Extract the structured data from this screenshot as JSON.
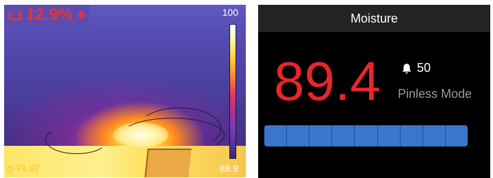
{
  "thermal": {
    "reading": "12.9%",
    "scale_max": "100",
    "scale_min": "88.9",
    "brand": "FLIR",
    "icons": {
      "moisture": "moisture-meter-icon",
      "alarm": "bell-icon"
    }
  },
  "panel": {
    "title": "Moisture",
    "value": "89.4",
    "alarm_threshold": "50",
    "mode": "Pinless Mode",
    "bar_segments": 9,
    "colors": {
      "value": "#e8252c",
      "bar": "#3a77cc",
      "header_bg": "#232323"
    }
  }
}
